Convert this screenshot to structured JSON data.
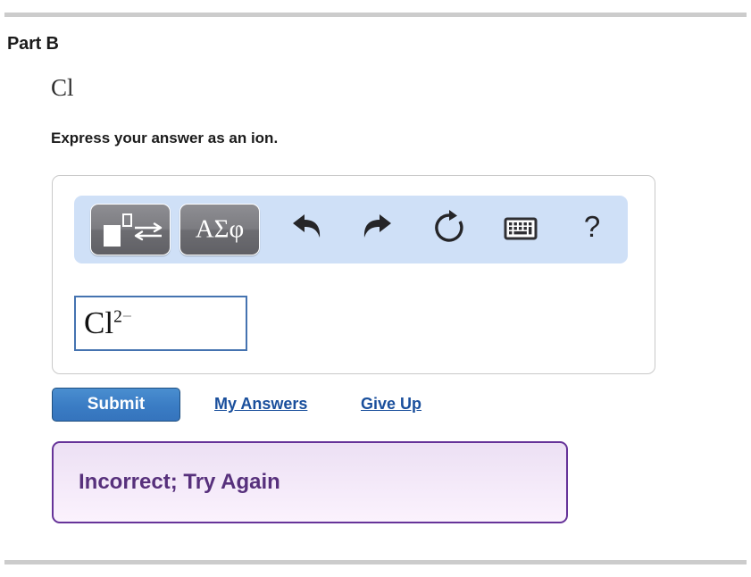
{
  "page": {
    "part_title": "Part B",
    "formula": "Cl",
    "instruction": "Express your answer as an ion."
  },
  "toolbar": {
    "buttons": [
      {
        "name": "template-button",
        "label": "",
        "icon": "exponent-template-icon"
      },
      {
        "name": "greek-symbols-button",
        "label": "ΑΣφ",
        "icon": "greek-letters-icon"
      }
    ],
    "icons": [
      {
        "name": "undo-icon",
        "label": "undo"
      },
      {
        "name": "redo-icon",
        "label": "redo"
      },
      {
        "name": "reset-icon",
        "label": "reset"
      },
      {
        "name": "keyboard-icon",
        "label": "keyboard"
      },
      {
        "name": "help-icon",
        "label": "?"
      }
    ]
  },
  "answer": {
    "base": "Cl",
    "superscript_number": "2",
    "superscript_sign": "−",
    "full_value": "Cl2−"
  },
  "actions": {
    "submit_label": "Submit",
    "my_answers_label": "My Answers",
    "give_up_label": "Give Up"
  },
  "feedback": {
    "message": "Incorrect; Try Again"
  },
  "colors": {
    "toolbar_bg": "#cfe0f7",
    "submit_blue": "#3a7cc4",
    "link_blue": "#1a4f9c",
    "feedback_border": "#663399",
    "feedback_text": "#57307c",
    "input_border": "#4573b0",
    "rule_gray": "#cccccc"
  }
}
